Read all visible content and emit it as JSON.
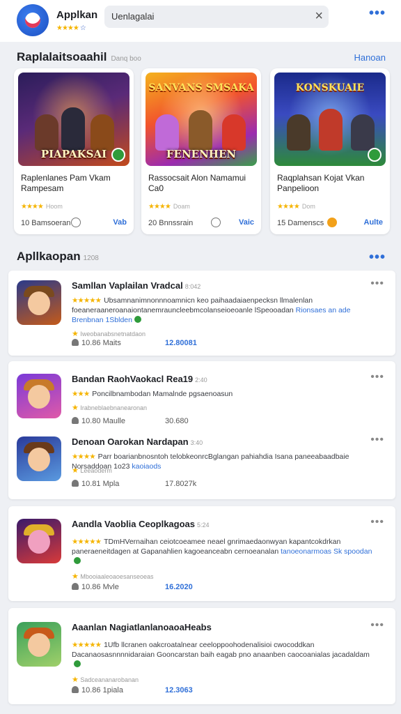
{
  "header": {
    "app_title": "Applkan",
    "app_stars": "★★★★",
    "app_rating": "☆",
    "search_value": "Uenlagalai",
    "clear_icon": "close-icon",
    "more_label": "•••"
  },
  "featured": {
    "title": "Raplalaitsoaahil",
    "subtitle": "Danq boo",
    "link": "Hanoan",
    "cards": [
      {
        "top_caption": "",
        "caption": "PIAPAKSAI",
        "name": "Raplenlanes Pam Vkam Rampesam",
        "stars": "★★★★",
        "stars_note": "Hoom",
        "size": "10 Bamsoeran",
        "action": "Vab"
      },
      {
        "top_caption": "SANVANS SMSAKA",
        "caption": "FENENHEN",
        "name": "Rassocsait Alon Namamui Ca0",
        "stars": "★★★★",
        "stars_note": "Doam",
        "size": "20 Bnnssrain",
        "action": "Vaic"
      },
      {
        "top_caption": "KONSKUAIE",
        "caption": "",
        "name": "Raqplahsan Kojat Vkan Panpelioon",
        "stars": "★★★★",
        "stars_note": "Dom",
        "size": "15 Damenscs",
        "action": "Aulte"
      }
    ]
  },
  "apps": {
    "title": "Apllkaopan",
    "count": "1208",
    "more_label": "•••",
    "items": [
      {
        "title": "Samllan Vaplailan Vradcal",
        "title_note": "8:042",
        "stars": "★★★★★",
        "desc": "Ubsamnanimnonnnoamnicn keo paihaadaiaenpecksn llmalenlan foeaneraaneroanaiontanemrauncleebmcolanseioeoanle lSpeooadan",
        "desc_link": "Rionsaes an ade Brenbnan 1Sblden",
        "meta": "Iweobanabsnetnatdaon",
        "downloads": "10.86 Maits",
        "size": "12.80081"
      },
      {
        "title": "Bandan RaohVaokacl Rea19",
        "title_note": "2:40",
        "stars": "★★★",
        "desc": "Poncilbnambodan Mamalnde pgsaenoasun",
        "desc_link": "",
        "meta": "Irabneblaebnanearonan",
        "downloads": "10.80 Maulle",
        "size": "30.680"
      },
      {
        "title": "Denoan Oarokan Nardapan",
        "title_note": "3:40",
        "stars": "★★★★",
        "desc": "Parr boarianbnosntoh telobkeonrcBglangan pahiahdia Isana paneeabaadbaie Norsaddoan 1o23",
        "desc_link": "kaoiaods",
        "meta": "Leeaoderm",
        "downloads": "10.81 Mpla",
        "size": "17.8027k"
      },
      {
        "title": "Aandla Vaoblia Ceoplkagoas",
        "title_note": "5:24",
        "stars": "★★★★★",
        "desc": "TDmHVernaihan ceiotcoeamee neael gnrimaedaonwyan kapantcokdrkan paneraeneitdagen at Gapanahlien kagoeanceabn cernoeanalan",
        "desc_link": "tanoeonarmoas Sk spoodan",
        "meta": "Mbooiaaleoaoesanseoeas",
        "downloads": "10.86 Mvle",
        "size": "16.2020"
      },
      {
        "title": "Aaanlan NagiatlanlanoaoaHeabs",
        "title_note": "",
        "stars": "★★★★★",
        "desc": "1Ufb llcranen oakcroatalnear ceeloppoohodenalisioi cwocoddkan Dacanaosasnnnnidaraian Gooncarstan baih eagab pno anaanben caocoanialas jacadaldam",
        "desc_link": "",
        "meta": "Sadceananarobanan",
        "downloads": "10.86 1piala",
        "size": "12.3063"
      }
    ]
  }
}
